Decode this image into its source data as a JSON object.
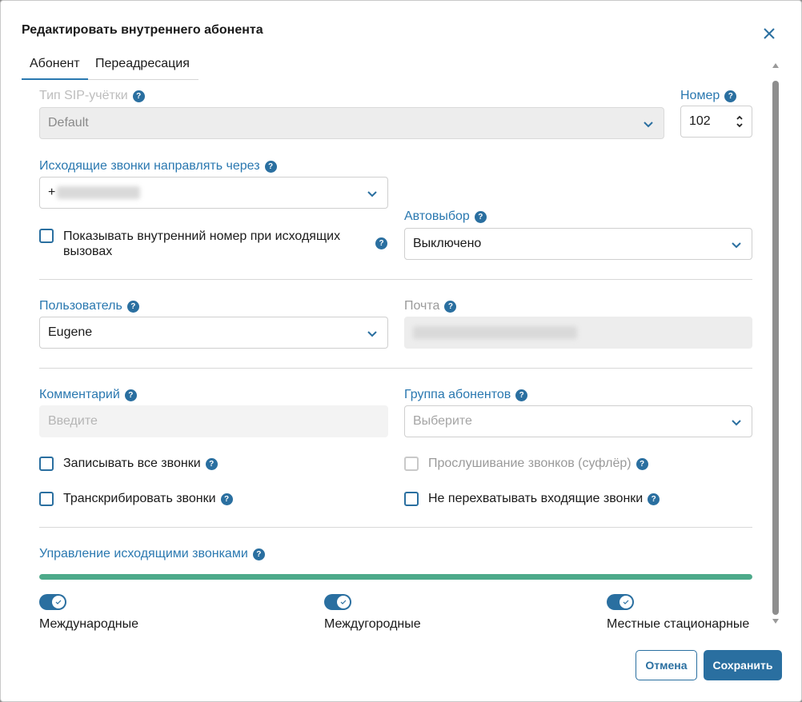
{
  "dialog": {
    "title": "Редактировать внутреннего абонента",
    "tabs": [
      {
        "label": "Абонент"
      },
      {
        "label": "Переадресация"
      }
    ]
  },
  "sip_type": {
    "label": "Тип SIP-учётки",
    "value": "Default"
  },
  "number": {
    "label": "Номер",
    "value": "102"
  },
  "outgoing_route": {
    "label": "Исходящие звонки направлять через",
    "value_prefix": "+"
  },
  "show_internal": {
    "label": "Показывать внутренний номер при исходящих вызовах",
    "checked": false
  },
  "autoselect": {
    "label": "Автовыбор",
    "value": "Выключено"
  },
  "user": {
    "label": "Пользователь",
    "value": "Eugene"
  },
  "email": {
    "label": "Почта"
  },
  "comment": {
    "label": "Комментарий",
    "placeholder": "Введите"
  },
  "subscriber_group": {
    "label": "Группа абонентов",
    "placeholder": "Выберите"
  },
  "checkboxes": {
    "record_all": {
      "label": "Записывать все звонки",
      "checked": false
    },
    "listen": {
      "label": "Прослушивание звонков (суфлёр)",
      "checked": false,
      "disabled": true
    },
    "transcribe": {
      "label": "Транскрибировать звонки",
      "checked": false
    },
    "no_intercept": {
      "label": "Не перехватывать входящие звонки",
      "checked": false
    }
  },
  "outgoing_control": {
    "label": "Управление исходящими звонками",
    "progress_fraction": 1.0,
    "toggles": [
      {
        "label": "Международные",
        "on": true
      },
      {
        "label": "Междугородные",
        "on": true
      },
      {
        "label": "Местные стационарные",
        "on": true
      }
    ]
  },
  "buttons": {
    "cancel": "Отмена",
    "save": "Сохранить"
  },
  "help_glyph": "?",
  "colors": {
    "accent": "#2a6fa0",
    "progress": "#4daa8a"
  }
}
